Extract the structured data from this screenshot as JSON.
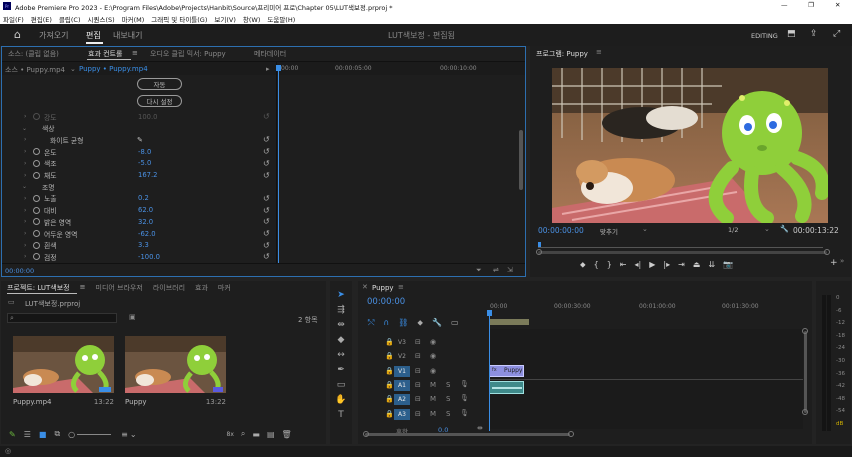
{
  "titlebar": {
    "title": "Adobe Premiere Pro 2023 - E:\\Program Files\\Adobe\\Projects\\Hanbit\\Source\\프리미어 프로\\Chapter 05\\LUT색보정.prproj *"
  },
  "menu": [
    "파일(F)",
    "편집(E)",
    "클립(C)",
    "시퀀스(S)",
    "마커(M)",
    "그래픽 및 타이틀(G)",
    "보기(V)",
    "창(W)",
    "도움말(H)"
  ],
  "workspace": {
    "tabs": [
      "가져오기",
      "편집",
      "내보내기"
    ],
    "active_tab": "편집",
    "project_title": "LUT색보정 - 편집됨",
    "editing_label": "EDITING"
  },
  "effect_panel": {
    "tabs": [
      "소스: (클립 없음)",
      "효과 컨트롤",
      "오디오 클립 믹서: Puppy",
      "메타데이터"
    ],
    "active_tab": "효과 컨트롤",
    "source_clip": "소스 • Puppy.mp4",
    "target_clip": "Puppy • Puppy.mp4",
    "auto_button": "자동",
    "reset_button": "다시 설정",
    "timecode": "00:00:00",
    "ruler": [
      "00:00",
      "00:00:05:00",
      "00:00:10:00"
    ],
    "rows": [
      {
        "indent": 1,
        "label": "강도",
        "value": "100.0",
        "kind": "dim"
      },
      {
        "indent": 0,
        "label": "색상",
        "value": "",
        "kind": "section"
      },
      {
        "indent": 1,
        "label": "화이트 균형",
        "value": "",
        "kind": "eyedropper"
      },
      {
        "indent": 1,
        "label": "온도",
        "value": "-8.0",
        "kind": "param"
      },
      {
        "indent": 1,
        "label": "색조",
        "value": "-5.0",
        "kind": "param"
      },
      {
        "indent": 1,
        "label": "채도",
        "value": "167.2",
        "kind": "param"
      },
      {
        "indent": 0,
        "label": "조명",
        "value": "",
        "kind": "section"
      },
      {
        "indent": 1,
        "label": "노출",
        "value": "0.2",
        "kind": "param"
      },
      {
        "indent": 1,
        "label": "대비",
        "value": "62.0",
        "kind": "param"
      },
      {
        "indent": 1,
        "label": "밝은 영역",
        "value": "32.0",
        "kind": "param"
      },
      {
        "indent": 1,
        "label": "어두운 영역",
        "value": "-62.0",
        "kind": "param"
      },
      {
        "indent": 1,
        "label": "흰색",
        "value": "3.3",
        "kind": "param"
      },
      {
        "indent": 1,
        "label": "검정",
        "value": "-100.0",
        "kind": "param"
      }
    ]
  },
  "program": {
    "title": "프로그램: Puppy",
    "timecode": "00:00:00:00",
    "fit": "맞추기",
    "resolution": "1/2",
    "duration": "00:00:13:22"
  },
  "project_panel": {
    "tabs": [
      "프로젝트: LUT색보정",
      "미디어 브라우저",
      "라이브러리",
      "효과",
      "마커"
    ],
    "active_tab": "프로젝트: LUT색보정",
    "file": "LUT색보정.prproj",
    "item_count": "2 항목",
    "items": [
      {
        "name": "Puppy.mp4",
        "duration": "13:22"
      },
      {
        "name": "Puppy",
        "duration": "13:22"
      }
    ],
    "zoom_label": "8x"
  },
  "timeline": {
    "sequence": "Puppy",
    "timecode": "00:00:00",
    "ruler": [
      "00:00",
      "00:00:30:00",
      "00:01:00:00",
      "00:01:30:00"
    ],
    "video_tracks": [
      "V3",
      "V2",
      "V1"
    ],
    "audio_tracks": [
      "A1",
      "A2",
      "A3"
    ],
    "mix_label": "혼합",
    "mix_value": "0.0",
    "clip_name": "Puppy",
    "track_letters": {
      "m": "M",
      "s": "S"
    }
  },
  "meter": {
    "scale": [
      "0",
      "-6",
      "-12",
      "-18",
      "-24",
      "-30",
      "-36",
      "-42",
      "-48",
      "-54",
      "dB"
    ]
  },
  "colors": {
    "accent": "#4a90e2",
    "panel_bg": "#1e1e1e",
    "clip_video": "#8d8fe0",
    "clip_audio": "#3f8a8a"
  }
}
